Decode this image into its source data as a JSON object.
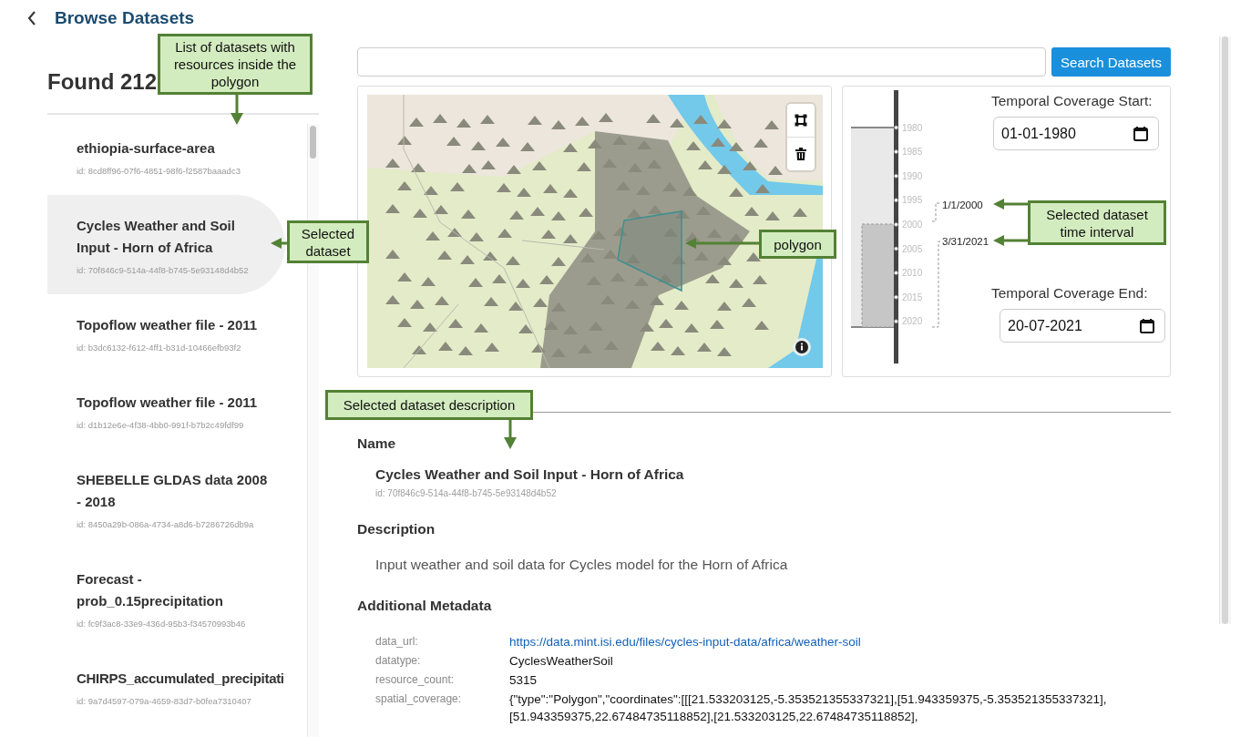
{
  "header": {
    "title": "Browse Datasets"
  },
  "sidebar": {
    "found": "Found 212",
    "datasets": [
      {
        "name": "ethiopia-surface-area",
        "id": "id: 8cd8ff96-07f6-4851-98f6-f2587baaadc3",
        "selected": false
      },
      {
        "name": "Cycles Weather and Soil Input - Horn of Africa",
        "id": "id: 70f846c9-514a-44f8-b745-5e93148d4b52",
        "selected": true
      },
      {
        "name": "Topoflow weather file - 2011",
        "id": "id: b3dc6132-f612-4ff1-b31d-10466efb93f2",
        "selected": false
      },
      {
        "name": "Topoflow weather file - 2011",
        "id": "id: d1b12e6e-4f38-4bb0-991f-b7b2c49fdf99",
        "selected": false
      },
      {
        "name": "SHEBELLE GLDAS data 2008 - 2018",
        "id": "id: 8450a29b-086a-4734-a8d6-b7286726db9a",
        "selected": false
      },
      {
        "name": "Forecast - prob_0.15precipitation",
        "id": "id: fc9f3ac8-33e9-436d-95b3-f34570993b46",
        "selected": false
      },
      {
        "name": "CHIRPS_accumulated_precipitati",
        "id": "id: 9a7d4597-079a-4659-83d7-b0fea7310407",
        "selected": false
      }
    ]
  },
  "search": {
    "button": "Search Datasets"
  },
  "timeline": {
    "ticks": [
      "1980",
      "1985",
      "1990",
      "1995",
      "2000",
      "2005",
      "2010",
      "2015",
      "2020"
    ],
    "interval_start": "1/1/2000",
    "interval_end": "3/31/2021",
    "start_field": {
      "label": "Temporal Coverage Start:",
      "value": "01-01-1980"
    },
    "end_field": {
      "label": "Temporal Coverage End:",
      "value": "20-07-2021"
    }
  },
  "details": {
    "name_heading": "Name",
    "name": "Cycles Weather and Soil Input - Horn of Africa",
    "id": "id: 70f846c9-514a-44f8-b745-5e93148d4b52",
    "description_heading": "Description",
    "description": "Input weather and soil data for Cycles model for the Horn of Africa",
    "metadata_heading": "Additional Metadata",
    "metadata": [
      {
        "key": "data_url:",
        "kind": "link",
        "lines": [
          "https://data.mint.isi.edu/files/cycles-input-data/africa/weather-soil"
        ]
      },
      {
        "key": "datatype:",
        "kind": "text",
        "lines": [
          "CyclesWeatherSoil"
        ]
      },
      {
        "key": "resource_count:",
        "kind": "text",
        "lines": [
          "5315"
        ]
      },
      {
        "key": "spatial_coverage:",
        "kind": "text",
        "lines": [
          "{\"type\":\"Polygon\",\"coordinates\":[[[21.533203125,-5.353521355337321],[51.943359375,-5.353521355337321],",
          "[51.943359375,22.67484735118852],[21.533203125,22.67484735118852],"
        ]
      }
    ]
  },
  "annotations": [
    {
      "text": "List of datasets with resources inside the polygon"
    },
    {
      "text": "Selected dataset"
    },
    {
      "text": "polygon"
    },
    {
      "text": "Selected dataset time interval"
    },
    {
      "text": "Selected dataset description"
    }
  ]
}
